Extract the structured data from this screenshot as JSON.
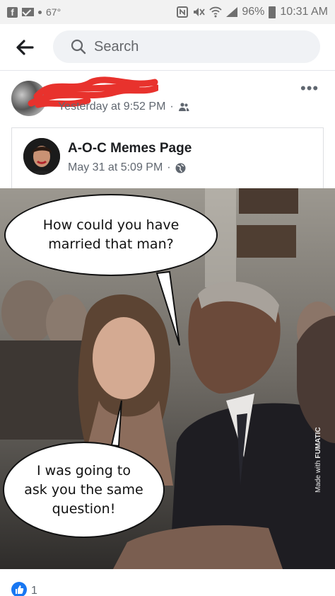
{
  "status_bar": {
    "temperature": "67°",
    "battery": "96%",
    "time": "10:31 AM"
  },
  "search": {
    "placeholder": "Search"
  },
  "post": {
    "timestamp": "Yesterday at 9:52 PM",
    "separator": "·",
    "audience_icon": "friends-icon",
    "more_label": "•••"
  },
  "shared_post": {
    "page_name": "A-O-C Memes Page",
    "timestamp": "May 31 at 5:09 PM",
    "separator": "·",
    "audience_icon": "globe-icon"
  },
  "meme": {
    "bubble_top": "How could you have married that man?",
    "bubble_bottom": "I was going to ask you the same question!",
    "watermark_prefix": "Made with ",
    "watermark_brand": "FUMATIC"
  },
  "reactions": {
    "count": "1",
    "icon": "like-icon"
  },
  "colors": {
    "facebook_blue": "#1877f2",
    "redaction_red": "#e8322d",
    "secondary_text": "#606770"
  }
}
